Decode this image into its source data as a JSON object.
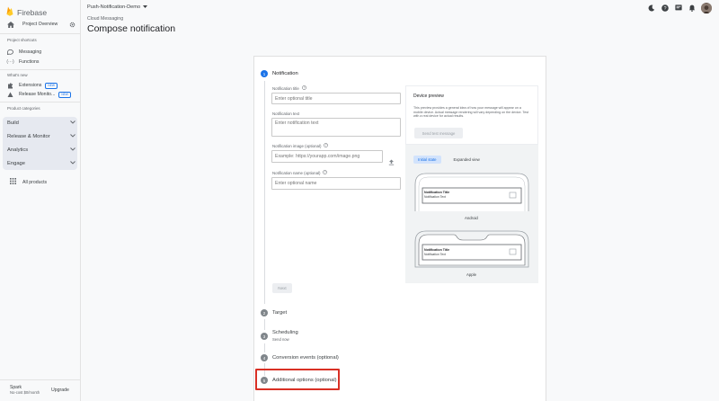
{
  "brand": {
    "name": "Firebase"
  },
  "sidebar": {
    "project_overview": "Project Overview",
    "shortcuts_label": "Project shortcuts",
    "shortcuts": [
      {
        "label": "Messaging",
        "icon": "messaging-icon"
      },
      {
        "label": "Functions",
        "icon": "functions-icon"
      }
    ],
    "whats_new_label": "What's new",
    "whats_new": [
      {
        "label": "Extensions",
        "badge": "NEW",
        "icon": "extensions-icon"
      },
      {
        "label": "Release Monito...",
        "badge": "NEW",
        "icon": "release-monitor-icon"
      }
    ],
    "categories_label": "Product categories",
    "categories": [
      "Build",
      "Release & Monitor",
      "Analytics",
      "Engage"
    ],
    "all_products": "All products",
    "plan_name": "Spark",
    "plan_price": "No-cost $0/month",
    "upgrade_label": "Upgrade"
  },
  "header": {
    "project_name": "Push-Notification-Demo",
    "breadcrumb": "Cloud Messaging",
    "page_title": "Compose notification"
  },
  "steps": [
    {
      "num": "1",
      "title": "Notification",
      "sub": ""
    },
    {
      "num": "2",
      "title": "Target",
      "sub": ""
    },
    {
      "num": "3",
      "title": "Scheduling",
      "sub": "Send now"
    },
    {
      "num": "4",
      "title": "Conversion events (optional)",
      "sub": ""
    },
    {
      "num": "5",
      "title": "Additional options (optional)",
      "sub": ""
    }
  ],
  "form": {
    "title_label": "Notification title",
    "title_placeholder": "Enter optional title",
    "text_label": "Notification text",
    "text_placeholder": "Enter notification text",
    "image_label": "Notification image (optional)",
    "image_placeholder": "Example: https://yourapp.com/image.png",
    "name_label": "Notification name (optional)",
    "name_placeholder": "Enter optional name",
    "next_label": "Next"
  },
  "preview": {
    "title": "Device preview",
    "description": "This preview provides a general idea of how your message will appear on a mobile device. Actual message rendering will vary depending on the device. Test with a real device for actual results.",
    "send_test_label": "Send test message",
    "tab_initial": "Initial state",
    "tab_expanded": "Expanded view",
    "notif_title": "Notification Title",
    "notif_text": "Notification Text",
    "android_label": "Android",
    "apple_label": "Apple"
  },
  "colors": {
    "accent": "#1a73e8",
    "highlight": "#d93025"
  }
}
